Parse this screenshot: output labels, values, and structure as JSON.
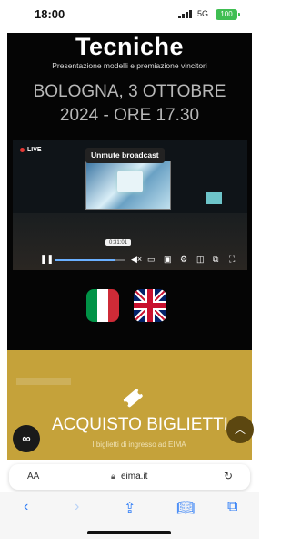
{
  "status": {
    "time": "18:00",
    "network": "5G",
    "battery": "100"
  },
  "hero": {
    "title": "Tecniche",
    "subtitle": "Presentazione modelli e premiazione vincitori",
    "when_line1": "BOLOGNA, 3 OTTOBRE",
    "when_line2": "2024 - ORE 17.30"
  },
  "video": {
    "live_label": "LIVE",
    "unmute_label": "Unmute broadcast",
    "time_badge": "0:31:01",
    "progress": 0.85
  },
  "languages": [
    "Italiano",
    "English"
  ],
  "tickets": {
    "label": "ACQUISTO BIGLIETTI",
    "note": "I biglietti di ingresso ad EIMA"
  },
  "browser": {
    "text_size_label": "AA",
    "url": "eima.it"
  },
  "colors": {
    "ticket_bg": "#c5a23a",
    "hero_bg": "#050505",
    "accent": "#2e7cf6"
  }
}
